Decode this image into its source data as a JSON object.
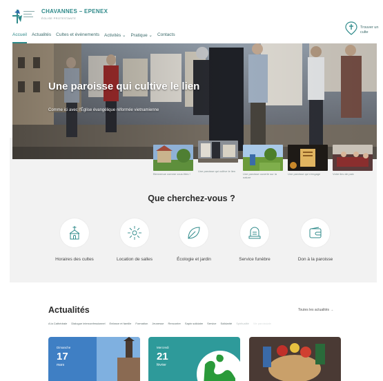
{
  "brand": {
    "title": "CHAVANNES – EPENEX",
    "subtitle": "ÉGLISE PROTESTANTE"
  },
  "nav": {
    "items": [
      {
        "label": "Accueil"
      },
      {
        "label": "Actualités"
      },
      {
        "label": "Cultes et évènements"
      },
      {
        "label": "Activités ⌄"
      },
      {
        "label": "Pratique ⌄"
      },
      {
        "label": "Contacts"
      }
    ]
  },
  "locate": {
    "label": "Trouver un culte"
  },
  "hero": {
    "title": "Une paroisse qui cultive le lien",
    "subtitle": "Comme ici avec l'Église évangélique réformée vietnamienne"
  },
  "thumbnails": [
    {
      "caption": "Bienvenue comme vous êtes !"
    },
    {
      "caption": "Une paroisse qui cultive le lien"
    },
    {
      "caption": "Une paroisse ouverte sur la nature"
    },
    {
      "caption": "Une paroisse qui s'engage"
    },
    {
      "caption": "Votre lieu de paix"
    }
  ],
  "search": {
    "title": "Que cherchez-vous ?",
    "items": [
      {
        "label": "Horaires des cultes",
        "icon": "church-icon"
      },
      {
        "label": "Location de salles",
        "icon": "sun-burst-icon"
      },
      {
        "label": "Écologie et jardin",
        "icon": "leaf-icon"
      },
      {
        "label": "Service funèbre",
        "icon": "bell-icon"
      },
      {
        "label": "Don à la paroisse",
        "icon": "wallet-icon"
      }
    ]
  },
  "news": {
    "title": "Actualités",
    "all_link": "Toutes les actualités →",
    "categories": [
      "A la Cathédrale",
      "Dialogue interconfessionnel",
      "Enfance et famille",
      "Formation",
      "Jeunesse",
      "Rencontre",
      "Sapin solidaire",
      "Service",
      "Solidarité",
      "Spiritualité",
      "Vie paroissiale"
    ],
    "cards": [
      {
        "day": "Dimanche",
        "date": "17",
        "month": "mars"
      },
      {
        "day": "Mercredi",
        "date": "21",
        "month": "février"
      },
      {
        "day": "",
        "date": "",
        "month": ""
      }
    ]
  },
  "colors": {
    "accent": "#2e8a8a",
    "panel": "#f2f2f2",
    "text": "#2a2a2a"
  }
}
